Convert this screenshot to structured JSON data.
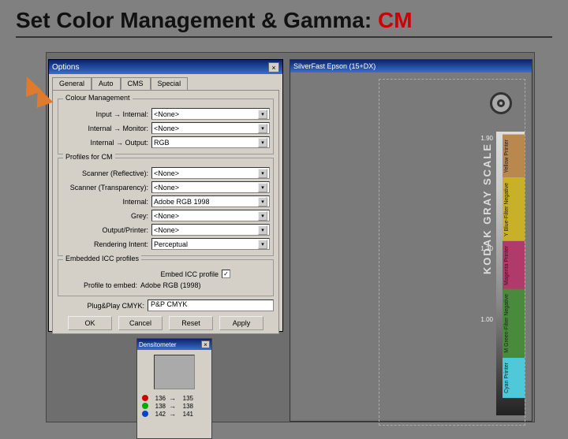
{
  "slide": {
    "title_prefix": "Set Color Management & Gamma: ",
    "title_cm": "CM"
  },
  "dialog": {
    "title": "Options",
    "tabs": {
      "general": "General",
      "auto": "Auto",
      "cms": "CMS",
      "special": "Special"
    },
    "colour_management": {
      "title": "Colour Management",
      "input_internal": {
        "label": "Input → Internal:",
        "value": "<None>"
      },
      "internal_monitor": {
        "label": "Internal → Monitor:",
        "value": "<None>"
      },
      "internal_output": {
        "label": "Internal → Output:",
        "value": "RGB"
      }
    },
    "profiles": {
      "title": "Profiles for CM",
      "scanner_reflective": {
        "label": "Scanner (Reflective):",
        "value": "<None>"
      },
      "scanner_transparency": {
        "label": "Scanner (Transparency):",
        "value": "<None>"
      },
      "internal": {
        "label": "Internal:",
        "value": "Adobe RGB 1998"
      },
      "grey": {
        "label": "Grey:",
        "value": "<None>"
      },
      "output_printer": {
        "label": "Output/Printer:",
        "value": "<None>"
      },
      "rendering_intent": {
        "label": "Rendering Intent:",
        "value": "Perceptual"
      }
    },
    "embed": {
      "title": "Embedded ICC profiles",
      "embed_label": "Embed ICC profile",
      "profile_to_embed_label": "Profile to embed:",
      "profile_to_embed_value": "Adobe RGB (1998)"
    },
    "plugnplay": {
      "label": "Plug&Play CMYK:",
      "value": "P&P CMYK"
    },
    "buttons": {
      "ok": "OK",
      "cancel": "Cancel",
      "reset": "Reset",
      "apply": "Apply"
    }
  },
  "densitometer": {
    "title": "Densitometer",
    "rows": [
      {
        "color": "#c00",
        "in": "136",
        "out": "135"
      },
      {
        "color": "#0a0",
        "in": "138",
        "out": "138"
      },
      {
        "color": "#04c",
        "in": "142",
        "out": "141"
      }
    ]
  },
  "document": {
    "title": "SilverFast Epson (15+DX)",
    "kodak": "KODAK GRAY SCALE",
    "bands": [
      {
        "label": "Cyan Printer",
        "bg": "#4fc9d9"
      },
      {
        "label": "M  Green-Filter Negative",
        "bg": "#4a8a3d"
      },
      {
        "label": "Magenta Printer",
        "bg": "#b03a6a"
      },
      {
        "label": "Y  Blue-Filter Negative",
        "bg": "#c9b029"
      },
      {
        "label": "Yellow Printer",
        "bg": "#b8884f"
      }
    ],
    "ticks": [
      "1.90",
      "1.30",
      "1.00"
    ]
  }
}
